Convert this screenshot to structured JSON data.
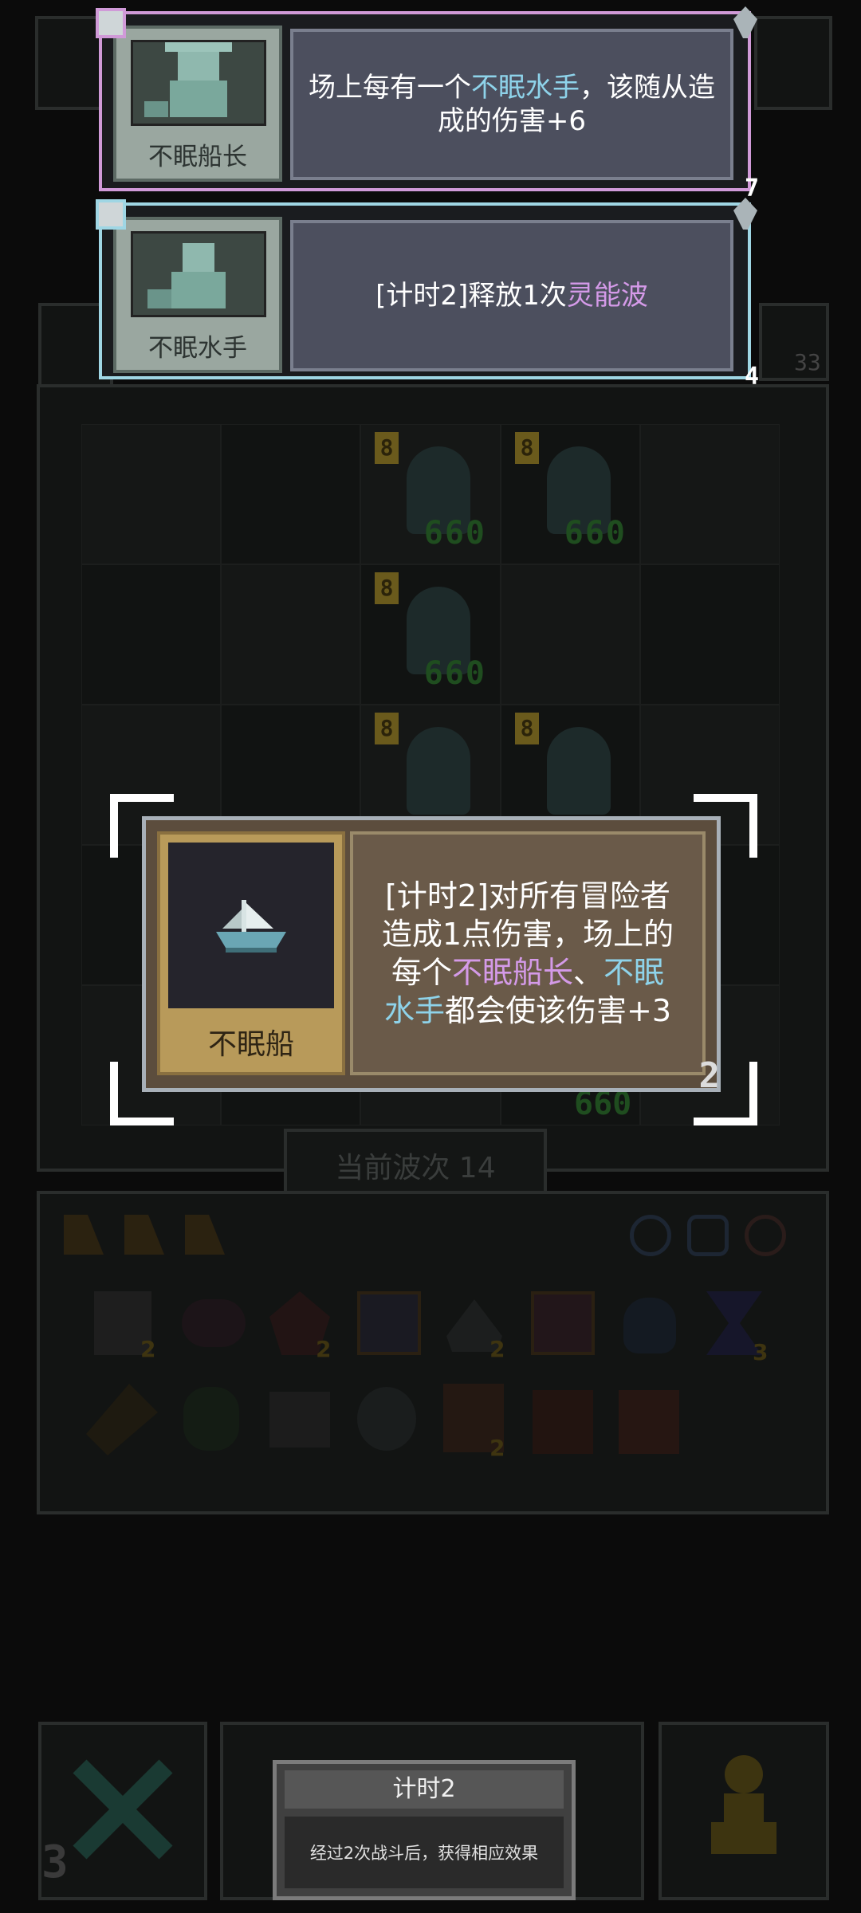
{
  "cards": [
    {
      "unit_name": "不眠船长",
      "desc_prefix": "场上每有一个",
      "desc_highlight": "不眠水手",
      "desc_suffix": "，该随从造成的伤害+6",
      "badge": "7",
      "border_color": "#d09ad8"
    },
    {
      "unit_name": "不眠水手",
      "desc_prefix": "[计时2]释放1次",
      "desc_highlight": "灵能波",
      "desc_suffix": "",
      "badge": "4",
      "border_color": "#9fd6e4"
    }
  ],
  "side_badge": "33",
  "board": {
    "units": [
      {
        "level": "8",
        "hp": "660"
      },
      {
        "level": "8",
        "hp": "660"
      },
      {
        "level": "8",
        "hp": "660"
      },
      {
        "level": "8",
        "hp": ""
      },
      {
        "level": "8",
        "hp": ""
      }
    ],
    "bottom_hp": "660",
    "wave_label": "当前波次 14"
  },
  "featured": {
    "name": "不眠船",
    "line1": "[计时2]对所有冒险者",
    "line2": "造成1点伤害，场上的",
    "line3_prefix": "每个",
    "line3_hl1": "不眠船长",
    "line3_sep": "、",
    "line3_hl2a": "不眠",
    "line4_hl2b": "水手",
    "line4_suffix": "都会使该伤害+3",
    "badge": "2"
  },
  "inventory": {
    "counts": [
      "2",
      "2",
      "2",
      "3",
      "2"
    ]
  },
  "bottom": {
    "left_count": "3",
    "tooltip_title": "计时2",
    "tooltip_body": "经过2次战斗后，获得相应效果"
  },
  "colors": {
    "highlight_blue": "#8ed3ea",
    "highlight_purple": "#d49ae8",
    "level_badge": "#6a5a1c",
    "hp_text": "#1f4d1f"
  }
}
